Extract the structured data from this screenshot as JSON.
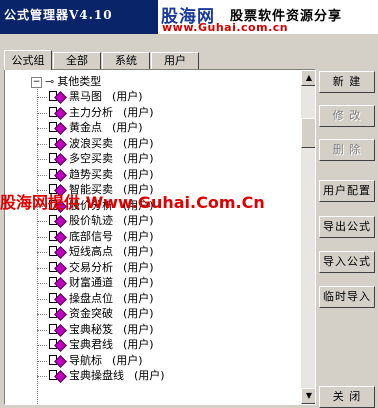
{
  "window": {
    "title": "公式管理器V4.10"
  },
  "banner": {
    "brand": "股海网",
    "tagline": "股票软件资源分享",
    "url": "www.Guhai.com.cn"
  },
  "tabs": [
    {
      "label": "公式组",
      "active": true
    },
    {
      "label": "全部",
      "active": false
    },
    {
      "label": "系统",
      "active": false
    },
    {
      "label": "用户",
      "active": false
    }
  ],
  "tree": {
    "group_label": "其他类型",
    "items": [
      {
        "name": "黑马图",
        "tag": "(用户)"
      },
      {
        "name": "主力分析",
        "tag": "(用户)"
      },
      {
        "name": "黄金点",
        "tag": "(用户)"
      },
      {
        "name": "波浪买卖",
        "tag": "(用户)"
      },
      {
        "name": "多空买卖",
        "tag": "(用户)"
      },
      {
        "name": "趋势买卖",
        "tag": "(用户)"
      },
      {
        "name": "智能买卖",
        "tag": "(用户)"
      },
      {
        "name": "股价分析",
        "tag": "(用户)"
      },
      {
        "name": "股价轨迹",
        "tag": "(用户)"
      },
      {
        "name": "底部信号",
        "tag": "(用户)"
      },
      {
        "name": "短线高点",
        "tag": "(用户)"
      },
      {
        "name": "交易分析",
        "tag": "(用户)"
      },
      {
        "name": "财富通道",
        "tag": "(用户)"
      },
      {
        "name": "操盘点位",
        "tag": "(用户)"
      },
      {
        "name": "资金突破",
        "tag": "(用户)"
      },
      {
        "name": "宝典秘笈",
        "tag": "(用户)"
      },
      {
        "name": "宝典君线",
        "tag": "(用户)"
      },
      {
        "name": "导航标",
        "tag": "(用户)"
      },
      {
        "name": "宝典操盘线",
        "tag": "(用户)"
      }
    ]
  },
  "buttons": {
    "new": "新 建",
    "edit": "修 改",
    "delete": "删 除",
    "user_config": "用户配置",
    "export": "导出公式",
    "import": "导入公式",
    "temp_import": "临时导入",
    "close": "关 闭"
  },
  "watermark": "股海网提供 Www.Guhai.Com.Cn"
}
